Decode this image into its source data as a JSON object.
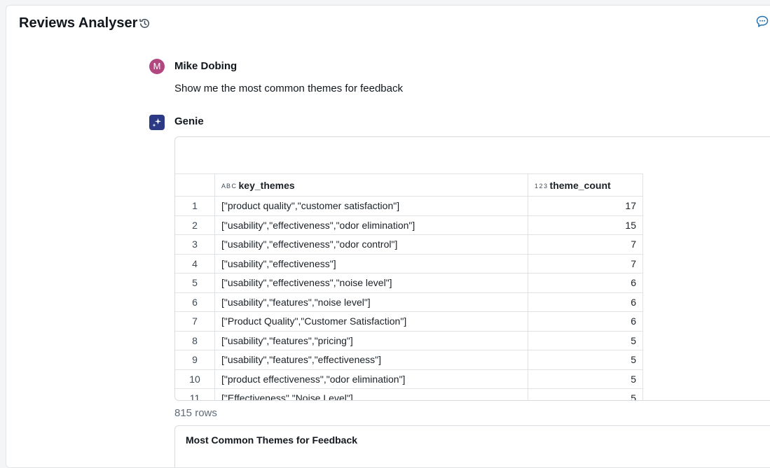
{
  "header": {
    "title": "Reviews Analyser"
  },
  "icons": {
    "history": "history-icon",
    "comment": "comment-icon",
    "genie": "sparkle-icon",
    "string_type": "string-type-icon",
    "number_type": "number-type-icon"
  },
  "colors": {
    "user_avatar": "#b2467f",
    "genie_avatar": "#2c3a86",
    "comment_icon": "#2272b4"
  },
  "conversation": {
    "user": {
      "avatar_initial": "M",
      "name": "Mike Dobing",
      "message": "Show me the most common themes for feedback"
    },
    "assistant": {
      "name": "Genie"
    }
  },
  "result_table": {
    "columns": {
      "themes_type": "A B C",
      "themes_label": "key_themes",
      "count_type": "1 2 3",
      "count_label": "theme_count"
    },
    "rows": [
      {
        "index": "1",
        "key_themes": "[\"product quality\",\"customer satisfaction\"]",
        "theme_count": "17"
      },
      {
        "index": "2",
        "key_themes": "[\"usability\",\"effectiveness\",\"odor elimination\"]",
        "theme_count": "15"
      },
      {
        "index": "3",
        "key_themes": "[\"usability\",\"effectiveness\",\"odor control\"]",
        "theme_count": "7"
      },
      {
        "index": "4",
        "key_themes": "[\"usability\",\"effectiveness\"]",
        "theme_count": "7"
      },
      {
        "index": "5",
        "key_themes": "[\"usability\",\"effectiveness\",\"noise level\"]",
        "theme_count": "6"
      },
      {
        "index": "6",
        "key_themes": "[\"usability\",\"features\",\"noise level\"]",
        "theme_count": "6"
      },
      {
        "index": "7",
        "key_themes": "[\"Product Quality\",\"Customer Satisfaction\"]",
        "theme_count": "6"
      },
      {
        "index": "8",
        "key_themes": "[\"usability\",\"features\",\"pricing\"]",
        "theme_count": "5"
      },
      {
        "index": "9",
        "key_themes": "[\"usability\",\"features\",\"effectiveness\"]",
        "theme_count": "5"
      },
      {
        "index": "10",
        "key_themes": "[\"product effectiveness\",\"odor elimination\"]",
        "theme_count": "5"
      },
      {
        "index": "11",
        "key_themes": "[\"Effectiveness\",\"Noise Level\"]",
        "theme_count": "5"
      }
    ],
    "row_count": "815 rows"
  },
  "chart_card": {
    "title": "Most Common Themes for Feedback"
  }
}
